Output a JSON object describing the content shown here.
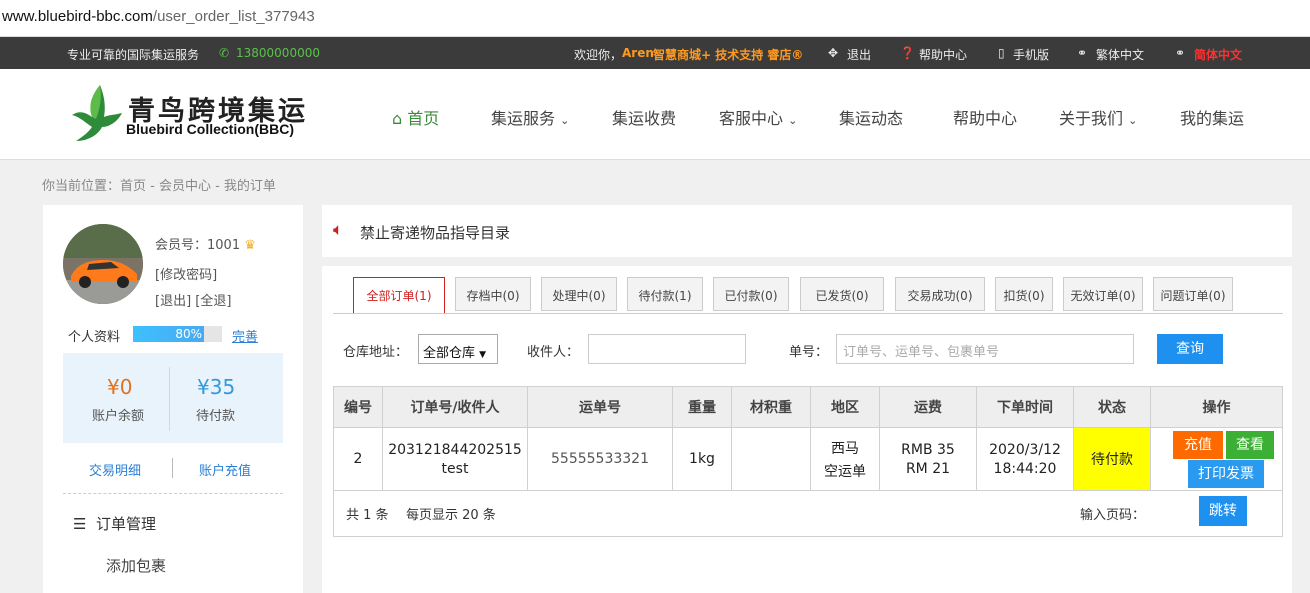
{
  "browser": {
    "url_domain": "www.bluebird-bbc.com",
    "url_path": "/user_order_list_377943"
  },
  "topbar": {
    "slogan": "专业可靠的国际集运服务",
    "phone": "13800000000",
    "welcome": "欢迎你，",
    "username": "Aren",
    "support_text": "智慧商城+ 技术支持 睿店®",
    "logout": "退出",
    "help_center": "帮助中心",
    "mobile": "手机版",
    "traditional": "繁体中文",
    "simplified": "简体中文"
  },
  "header": {
    "logo_cn": "青鸟跨境集运",
    "logo_en": "Bluebird Collection(BBC)",
    "nav": [
      "首页",
      "集运服务",
      "集运收费",
      "客服中心",
      "集运动态",
      "帮助中心",
      "关于我们",
      "我的集运"
    ]
  },
  "breadcrumb": "你当前位置：首页 - 会员中心 - 我的订单",
  "sidebar": {
    "member_no": "会员号：1001",
    "change_password": "[修改密码]",
    "logout_links": "[退出] [全退]",
    "profile_label": "个人资料",
    "profile_progress": 0.8,
    "profile_percent": "80%",
    "complete_link": "完善",
    "balance_value": "¥0",
    "balance_label": "账户余额",
    "pending_value": "¥35",
    "pending_label": "待付款",
    "transactions": "交易明细",
    "recharge": "账户充值",
    "order_mgmt": "订单管理",
    "add_package": "添加包裹"
  },
  "notice": "禁止寄递物品指导目录",
  "tabs": [
    "全部订单(1)",
    "存档中(0)",
    "处理中(0)",
    "待付款(1)",
    "已付款(0)",
    "已发货(0)",
    "交易成功(0)",
    "扣货(0)",
    "无效订单(0)",
    "问题订单(0)"
  ],
  "filters": {
    "warehouse_label": "仓库地址：",
    "warehouse_value": "全部仓库",
    "recipient_label": "收件人：",
    "recipient_value": "",
    "number_label": "单号：",
    "number_placeholder": "订单号、运单号、包裹单号",
    "search_button": "查询"
  },
  "table": {
    "headers": [
      "编号",
      "订单号/收件人",
      "运单号",
      "重量",
      "材积重",
      "地区",
      "运费",
      "下单时间",
      "状态",
      "操作"
    ],
    "rows": [
      {
        "id": "2",
        "order_no": "203121844202515",
        "recipient": "test",
        "waybill": "55555533321",
        "weight": "1kg",
        "volume_weight": "",
        "region_line1": "西马",
        "region_line2": "空运单",
        "fee_line1": "RMB 35",
        "fee_line2": "RM 21",
        "date": "2020/3/12",
        "time": "18:44:20",
        "status": "待付款",
        "action_recharge": "充值",
        "action_view": "查看",
        "action_invoice": "打印发票"
      }
    ]
  },
  "pagination": {
    "total": "共 1 条",
    "per_page": "每页显示 20 条",
    "page_label": "输入页码：",
    "jump_button": "跳转"
  },
  "colors": {
    "accent_blue": "#1e90f0",
    "status_yellow": "#ffff00",
    "orange_button": "#ff6a00",
    "green_button": "#3cb034",
    "nav_active": "#3b8a3b"
  }
}
